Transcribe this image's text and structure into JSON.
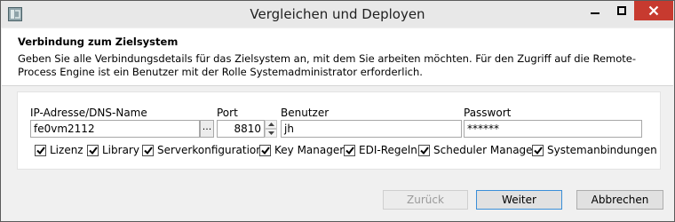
{
  "window": {
    "title": "Vergleichen und Deployen",
    "controls": [
      "minimize-icon",
      "maximize-icon",
      "close-icon"
    ],
    "close_color": "#c73a2f"
  },
  "header": {
    "title": "Verbindung zum Zielsystem",
    "description": "Geben Sie alle Verbindungsdetails für das Zielsystem an, mit dem Sie arbeiten möchten. Für den Zugriff auf die Remote-Process Engine ist ein Benutzer mit der Rolle Systemadministrator erforderlich."
  },
  "form": {
    "ip_label": "IP-Adresse/DNS-Name",
    "ip_value": "fe0vm2112",
    "browse_label": "...",
    "port_label": "Port",
    "port_value": "8810",
    "user_label": "Benutzer",
    "user_value": "jh",
    "password_label": "Passwort",
    "password_value": "******"
  },
  "checkboxes": [
    {
      "label": "Lizenz",
      "checked": true
    },
    {
      "label": "Library",
      "checked": true
    },
    {
      "label": "Serverkonfiguration",
      "checked": true
    },
    {
      "label": "Key Manager",
      "checked": true
    },
    {
      "label": "EDI-Regeln",
      "checked": true
    },
    {
      "label": "Scheduler Manager",
      "checked": true
    },
    {
      "label": "Systemanbindungen",
      "checked": true
    }
  ],
  "buttons": {
    "back": "Zurück",
    "next": "Weiter",
    "cancel": "Abbrechen"
  },
  "colors": {
    "accent_border": "#3b8fd8"
  }
}
